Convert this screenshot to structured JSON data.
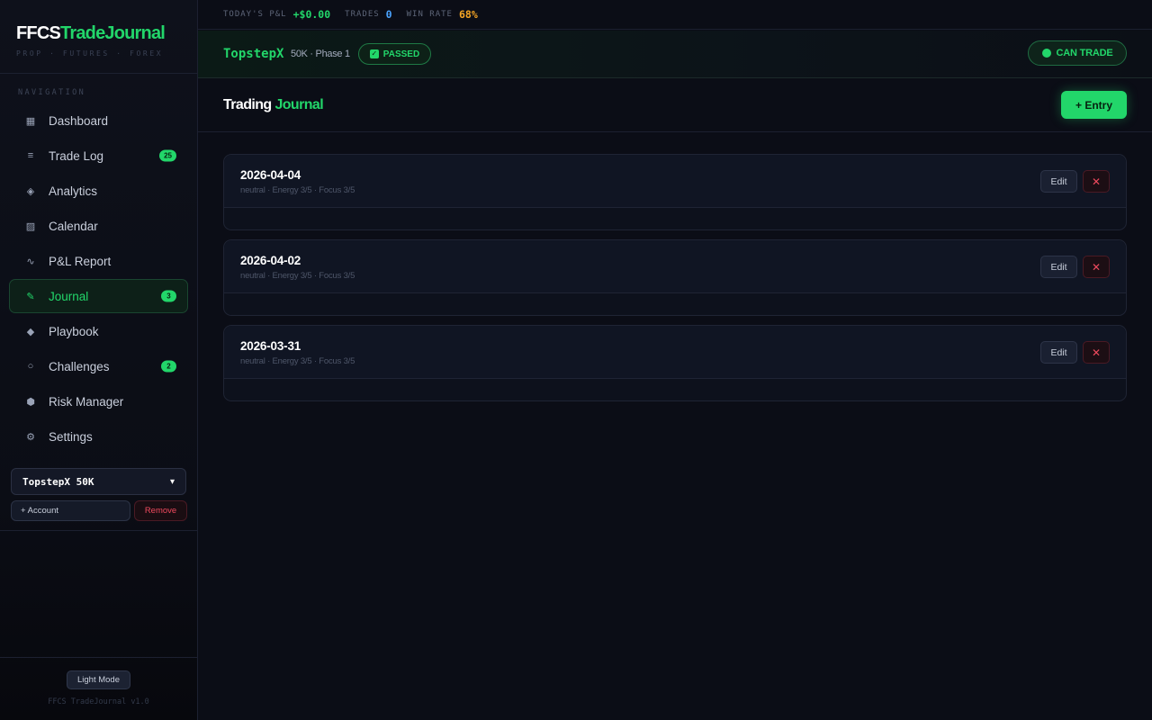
{
  "brand": {
    "title_white": "FFCS",
    "title_green": "TradeJournal",
    "subtitle": "PROP · FUTURES · FOREX"
  },
  "nav": {
    "heading": "NAVIGATION",
    "items": [
      {
        "label": "Dashboard",
        "icon": "dashboard-icon",
        "glyph": "▦",
        "badge": ""
      },
      {
        "label": "Trade Log",
        "icon": "list-icon",
        "glyph": "≡",
        "badge": "25"
      },
      {
        "label": "Analytics",
        "icon": "analytics-icon",
        "glyph": "◈",
        "badge": ""
      },
      {
        "label": "Calendar",
        "icon": "calendar-icon",
        "glyph": "▨",
        "badge": ""
      },
      {
        "label": "P&L Report",
        "icon": "wave-icon",
        "glyph": "∿",
        "badge": ""
      },
      {
        "label": "Journal",
        "icon": "pencil-icon",
        "glyph": "✎",
        "badge": "3",
        "active": true
      },
      {
        "label": "Playbook",
        "icon": "diamond-icon",
        "glyph": "◆",
        "badge": ""
      },
      {
        "label": "Challenges",
        "icon": "ring-icon",
        "glyph": "○",
        "badge": "2"
      },
      {
        "label": "Risk Manager",
        "icon": "shield-icon",
        "glyph": "⬢",
        "badge": ""
      },
      {
        "label": "Settings",
        "icon": "gear-icon",
        "glyph": "⚙",
        "badge": ""
      }
    ]
  },
  "account_selector": {
    "value": "TopstepX 50K",
    "add_label": "+ Account",
    "remove_label": "Remove"
  },
  "footer": {
    "light_mode_label": "Light Mode",
    "version": "FFCS TradeJournal v1.0"
  },
  "topbar": {
    "pnl_label": "TODAY'S P&L",
    "pnl_value": "+$0.00",
    "trades_label": "TRADES",
    "trades_value": "0",
    "winrate_label": "WIN RATE",
    "winrate_value": "68%"
  },
  "account_bar": {
    "name": "TopstepX",
    "desc": "50K · Phase 1",
    "status": "PASSED",
    "trade_status": "CAN TRADE"
  },
  "page": {
    "title_white": "Trading",
    "title_green": "Journal",
    "entry_button": "+ Entry"
  },
  "entries": [
    {
      "date": "2026-04-04",
      "meta": "neutral · Energy 3/5 · Focus 3/5",
      "edit_label": "Edit",
      "delete_glyph": "✕"
    },
    {
      "date": "2026-04-02",
      "meta": "neutral · Energy 3/5 · Focus 3/5",
      "edit_label": "Edit",
      "delete_glyph": "✕"
    },
    {
      "date": "2026-03-31",
      "meta": "neutral · Energy 3/5 · Focus 3/5",
      "edit_label": "Edit",
      "delete_glyph": "✕"
    }
  ],
  "colors": {
    "accent": "#22d66a",
    "danger": "#ef4a5e",
    "info": "#4aa3ff",
    "warning": "#f5a524",
    "background": "#0b0d16"
  }
}
